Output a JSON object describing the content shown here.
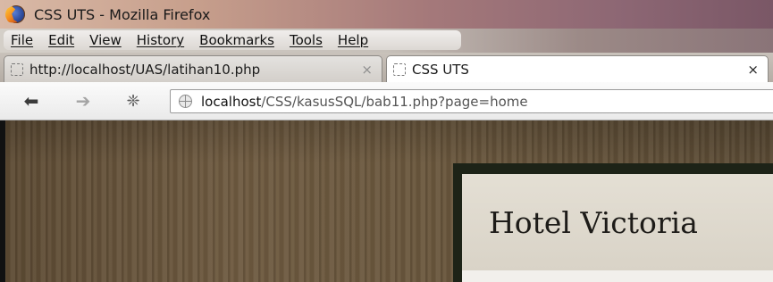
{
  "window": {
    "title": "CSS UTS - Mozilla Firefox"
  },
  "menu": {
    "items": [
      "File",
      "Edit",
      "View",
      "History",
      "Bookmarks",
      "Tools",
      "Help"
    ]
  },
  "tabs": [
    {
      "title": "http://localhost/UAS/latihan10.php",
      "close": "×",
      "active": false
    },
    {
      "title": "CSS UTS",
      "close": "×",
      "active": true
    }
  ],
  "nav": {
    "url_host": "localhost",
    "url_path": "/CSS/kasusSQL/bab11.php?page=home"
  },
  "page": {
    "heading": "Hotel Victoria"
  },
  "icons": {
    "back": "arrow-left",
    "forward": "arrow-right",
    "reload": "reload",
    "site": "globe"
  }
}
